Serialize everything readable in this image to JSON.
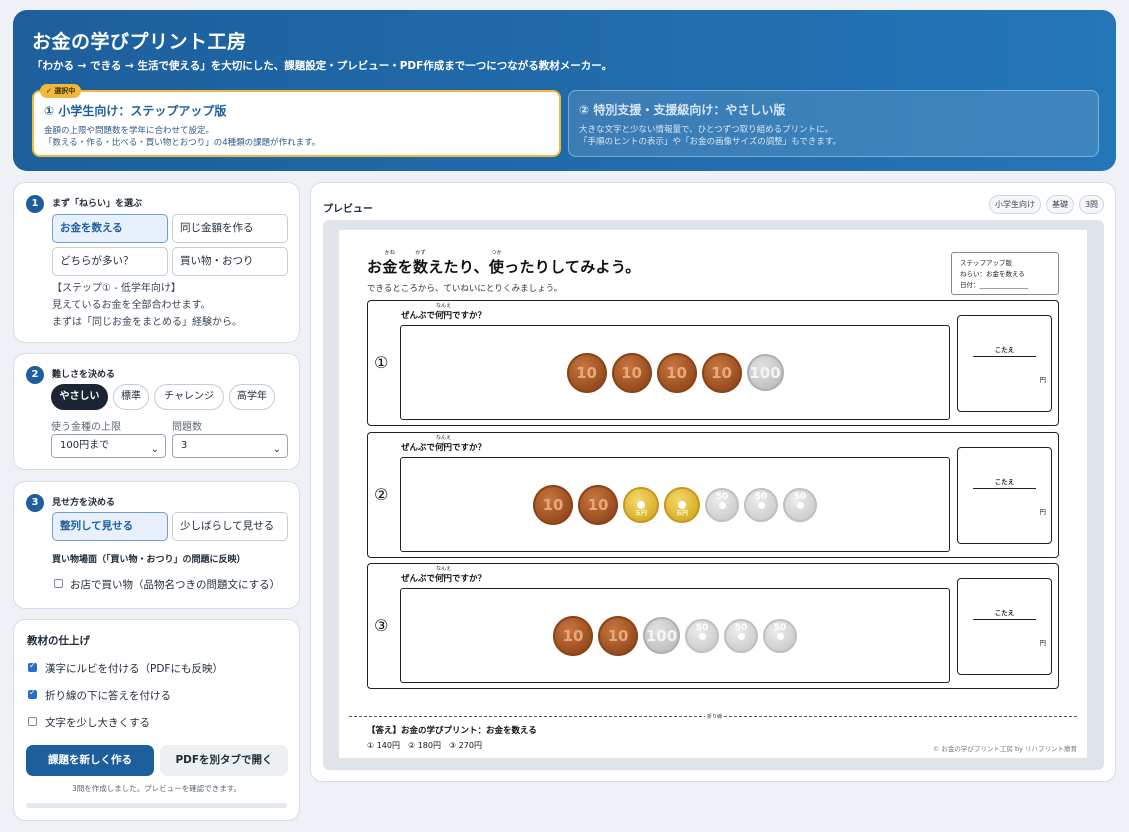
{
  "header": {
    "title": "お金の学びプリント工房",
    "subtitle": "「わかる → できる → 生活で使える」を大切にした、課題設定・プレビュー・PDF作成まで一つにつながる教材メーカー。",
    "selected_badge": "✓ 選択中",
    "modes": [
      {
        "title": "① 小学生向け：ステップアップ版",
        "line1": "金額の上限や問題数を学年に合わせて設定。",
        "line2": "「数える・作る・比べる・買い物とおつり」の4種類の課題が作れます。"
      },
      {
        "title": "② 特別支援・支援級向け：やさしい版",
        "line1": "大きな文字と少ない情報量で、ひとつずつ取り組めるプリントに。",
        "line2": "「手順のヒントの表示」や「お金の画像サイズの調整」もできます。"
      }
    ]
  },
  "step1": {
    "num": "1",
    "title": "まず「ねらい」を選ぶ",
    "options": [
      "お金を数える",
      "同じ金額を作る",
      "どちらが多い？",
      "買い物・おつり"
    ],
    "note1": "【ステップ① - 低学年向け】",
    "note2": "見えているお金を全部合わせます。",
    "note3": "まずは「同じお金をまとめる」経験から。"
  },
  "step2": {
    "num": "2",
    "title": "難しさを決める",
    "levels": [
      "やさしい",
      "標準",
      "チャレンジ",
      "高学年"
    ],
    "limit_label": "使う金種の上限",
    "limit_value": "100円まで",
    "count_label": "問題数",
    "count_value": "3"
  },
  "step3": {
    "num": "3",
    "title": "見せ方を決める",
    "options": [
      "整列して見せる",
      "少しばらして見せる"
    ],
    "shop_title": "買い物場面（「買い物・おつり」の問題に反映）",
    "shop_check": "お店で買い物（品物名つきの問題文にする）"
  },
  "finish": {
    "title": "教材の仕上げ",
    "checks": [
      "漢字にルビを付ける（PDFにも反映）",
      "折り線の下に答えを付ける",
      "文字を少し大きくする"
    ],
    "create_btn": "課題を新しく作る",
    "pdf_btn": "PDFを別タブで開く",
    "status": "3問を作成しました。プレビューを確認できます。"
  },
  "preview": {
    "title": "プレビュー",
    "tags": [
      "小学生向け",
      "基礎",
      "3問"
    ],
    "sheet": {
      "title_a": "お",
      "title_b": "金",
      "title_c": "を",
      "title_d": "数",
      "title_e": "えたり、",
      "title_f": "使",
      "title_g": "ったりしてみよう。",
      "ruby_kane": "かね",
      "ruby_kazu": "かず",
      "ruby_tsuka": "つか",
      "instruction": "できるところから、ていねいにとりくみましょう。",
      "info1": "ステップアップ版",
      "info2": "ねらい：お金を数える",
      "info3": "日付：_______________",
      "prompt_a": "ぜんぶで",
      "prompt_b": "何円",
      "prompt_c": "ですか？",
      "ruby_nanen": "なんえん",
      "answer_label": "こたえ",
      "yen": "円",
      "questions": [
        {
          "num": "①",
          "coins": [
            "10",
            "10",
            "10",
            "10",
            "100"
          ]
        },
        {
          "num": "②",
          "coins": [
            "10",
            "10",
            "5",
            "5",
            "50",
            "50",
            "50"
          ]
        },
        {
          "num": "③",
          "coins": [
            "10",
            "10",
            "100",
            "50",
            "50",
            "50"
          ]
        }
      ],
      "fold_label": "折り線",
      "answers_title": "【答え】お金の学びプリント：お金を数える",
      "answers": "① 140円　② 180円　③ 270円",
      "copyright": "© お金の学びプリント工房 by リハプリント療育",
      "coin_5_text": "五円"
    }
  }
}
